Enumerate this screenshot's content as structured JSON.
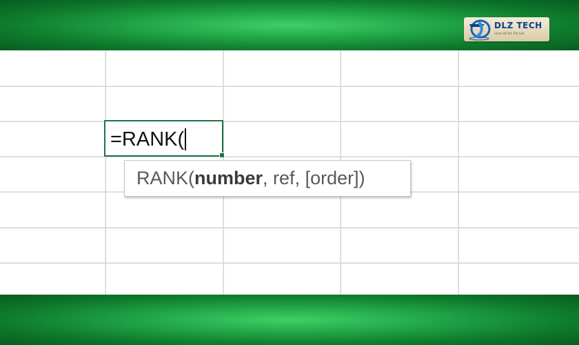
{
  "brand": {
    "name": "DLZ TECH",
    "tagline": "Chạm Để Mở Thế Giới"
  },
  "cell": {
    "formula": "=RANK("
  },
  "tooltip": {
    "function_name": "RANK",
    "open_paren": "(",
    "arg_current": "number",
    "sep1": ", ",
    "arg_ref": "ref",
    "sep2": ", ",
    "arg_order": "[order]",
    "close_paren": ")"
  },
  "colors": {
    "accent_green": "#217346",
    "banner_green": "#20a346",
    "gridline": "#d4d4d4"
  }
}
